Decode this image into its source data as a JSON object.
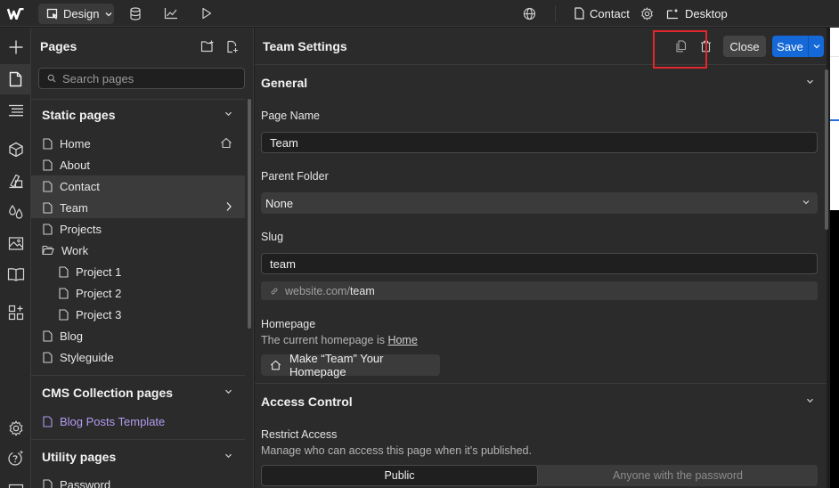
{
  "topbar": {
    "mode_label": "Design",
    "page_label": "Contact",
    "breakpoint_label": "Desktop",
    "icons": [
      "webflow-logo-icon",
      "cursor-icon",
      "database-icon",
      "chart-icon",
      "play-icon",
      "globe-icon",
      "page-icon",
      "gear-icon",
      "breakpoint-icon"
    ]
  },
  "rail": {
    "icons": [
      "add-icon",
      "pages-icon",
      "navigator-icon",
      "components-icon",
      "styles-icon",
      "drops-icon",
      "assets-icon",
      "book-icon",
      "apps-icon",
      "settings-icon",
      "help-icon"
    ]
  },
  "pages_panel": {
    "title": "Pages",
    "search_placeholder": "Search pages",
    "static_section": "Static pages",
    "static_pages": [
      "Home",
      "About",
      "Contact",
      "Team",
      "Projects",
      "Work",
      "Project 1",
      "Project 2",
      "Project 3",
      "Blog",
      "Styleguide"
    ],
    "cms_section": "CMS Collection pages",
    "cms_pages": [
      "Blog Posts Template"
    ],
    "utility_section": "Utility pages",
    "utility_pages": [
      "Password"
    ]
  },
  "settings": {
    "title": "Team Settings",
    "close_label": "Close",
    "save_label": "Save",
    "general_title": "General",
    "page_name_label": "Page Name",
    "page_name_value": "Team",
    "parent_folder_label": "Parent Folder",
    "parent_folder_value": "None",
    "slug_label": "Slug",
    "slug_value": "team",
    "slug_domain": "website.com/",
    "slug_path": "team",
    "homepage_label": "Homepage",
    "homepage_text": "The current homepage is ",
    "homepage_link": "Home",
    "make_homepage_label": "Make “Team” Your Homepage",
    "access_title": "Access Control",
    "restrict_label": "Restrict Access",
    "restrict_help": "Manage who can access this page when it's published.",
    "access_options": [
      "Public",
      "Anyone with the password"
    ]
  },
  "colors": {
    "accent": "#1468d8",
    "highlight": "#e0282b",
    "cms_text": "#b39bf0"
  }
}
